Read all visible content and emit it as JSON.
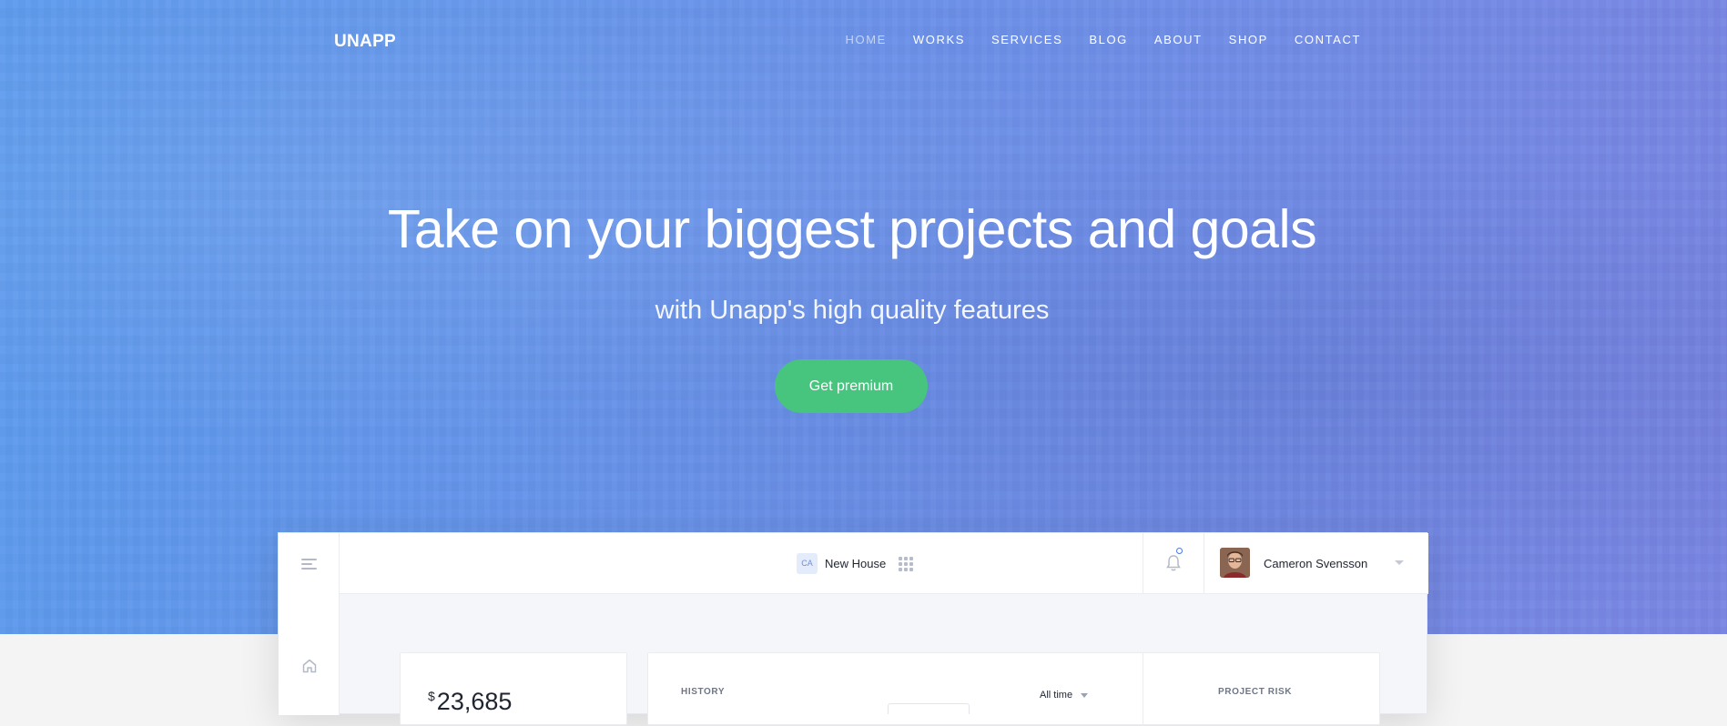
{
  "brand": {
    "logo": "UNAPP"
  },
  "nav": {
    "items": [
      {
        "label": "HOME",
        "active": true
      },
      {
        "label": "WORKS"
      },
      {
        "label": "SERVICES"
      },
      {
        "label": "BLOG"
      },
      {
        "label": "ABOUT"
      },
      {
        "label": "SHOP"
      },
      {
        "label": "CONTACT"
      }
    ]
  },
  "hero": {
    "headline": "Take on your biggest projects and goals",
    "subline": "with Unapp's high quality features",
    "cta_label": "Get premium"
  },
  "dashboard": {
    "project": {
      "badge": "CA",
      "name": "New House"
    },
    "user": {
      "name": "Cameron Svensson"
    },
    "balance": {
      "currency": "$",
      "amount": "23,685"
    },
    "history": {
      "label": "HISTORY",
      "filter": "All time"
    },
    "risk": {
      "label": "PROJECT RISK"
    }
  },
  "colors": {
    "hero_start": "#5d9bed",
    "hero_end": "#7a86e3",
    "cta": "#47c47e",
    "accent": "#4a78e8"
  }
}
